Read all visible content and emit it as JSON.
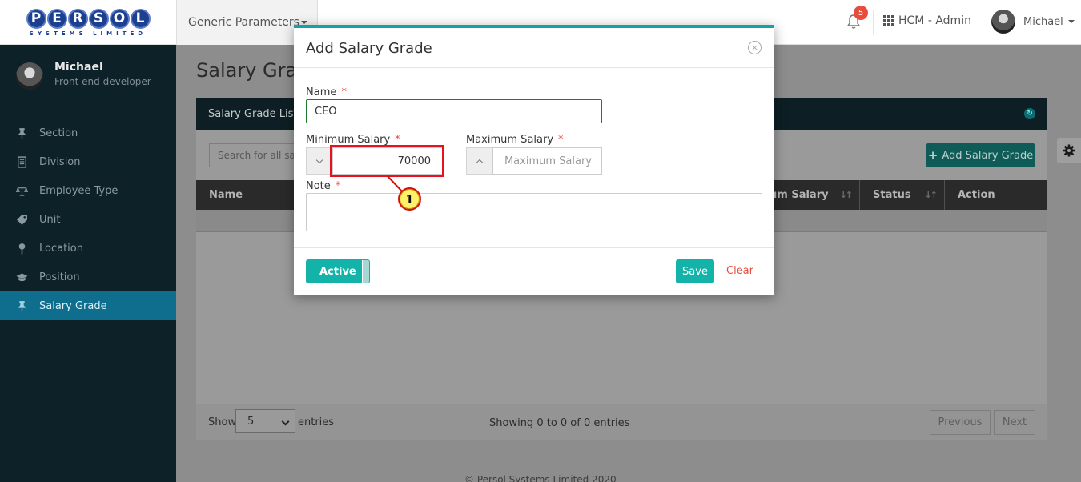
{
  "header": {
    "logo_letters": [
      "P",
      "E",
      "R",
      "S",
      "O",
      "L"
    ],
    "logo_subtitle": "SYSTEMS LIMITED",
    "module_menu": "Generic Parameters",
    "notification_count": "5",
    "app_switcher": "HCM - Admin",
    "user_name": "Michael"
  },
  "sidebar": {
    "user_name": "Michael",
    "user_role": "Front end developer",
    "items": [
      {
        "label": "Section",
        "icon": "pin-icon"
      },
      {
        "label": "Division",
        "icon": "document-icon"
      },
      {
        "label": "Employee Type",
        "icon": "scale-icon"
      },
      {
        "label": "Unit",
        "icon": "tag-icon"
      },
      {
        "label": "Location",
        "icon": "map-pin-icon"
      },
      {
        "label": "Position",
        "icon": "graduation-cap-icon"
      },
      {
        "label": "Salary Grade",
        "icon": "pin-icon",
        "active": true
      }
    ]
  },
  "main": {
    "page_title": "Salary Grad",
    "panel_title": "Salary Grade List",
    "search_placeholder": "Search for all sala",
    "add_button": "Add Salary Grade",
    "columns": [
      {
        "label": "Name"
      },
      {
        "label": "um Salary"
      },
      {
        "label": "Status"
      },
      {
        "label": "Action"
      }
    ],
    "show_label": "Show",
    "page_size": "5",
    "entries_label": "entries",
    "showing_text": "Showing 0 to 0 of 0 entries",
    "previous_label": "Previous",
    "next_label": "Next",
    "footer": "© Persol Systems Limited 2020"
  },
  "modal": {
    "title": "Add Salary Grade",
    "close_symbol": "×",
    "name_label": "Name",
    "name_value": "CEO",
    "min_salary_label": "Minimum Salary",
    "min_salary_value": "70000",
    "max_salary_label": "Maximum Salary",
    "max_salary_placeholder": "Maximum Salary",
    "note_label": "Note",
    "required_mark": "*",
    "active_label": "Active",
    "save_label": "Save",
    "clear_label": "Clear"
  },
  "annotation": {
    "callout_number": "1"
  },
  "colors": {
    "accent": "#14b3aa",
    "modal_top_border": "#14a3a3",
    "sidebar_bg": "#0d2128",
    "sidebar_active": "#0f6d8e",
    "required": "#e74c3c",
    "highlight": "#e8121e",
    "callout_fill": "#fff06a"
  }
}
